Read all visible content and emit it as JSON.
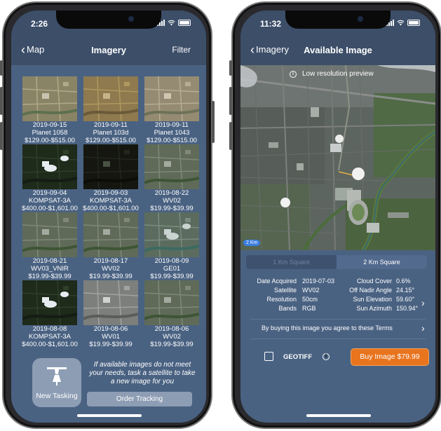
{
  "imagery_screen": {
    "status_time": "2:26",
    "back_label": "Map",
    "title": "Imagery",
    "filter_label": "Filter",
    "tiles": [
      {
        "date": "2019-09-15",
        "satellite": "Planet 1058",
        "price": "$129.00-$515.00",
        "scene": "urban-tan"
      },
      {
        "date": "2019-09-11",
        "satellite": "Planet 103d",
        "price": "$129.00-$515.00",
        "scene": "urban-gold"
      },
      {
        "date": "2019-09-11",
        "satellite": "Planet 1043",
        "price": "$129.00-$515.00",
        "scene": "urban-beige"
      },
      {
        "date": "2019-09-04",
        "satellite": "KOMPSAT-3A",
        "price": "$400.00-$1,601.00",
        "scene": "dark-cloud"
      },
      {
        "date": "2019-09-03",
        "satellite": "KOMPSAT-3A",
        "price": "$400.00-$1,601.00",
        "scene": "dark-black"
      },
      {
        "date": "2019-08-22",
        "satellite": "WV02",
        "price": "$19.99-$39.99",
        "scene": "green-urban"
      },
      {
        "date": "2019-08-21",
        "satellite": "WV03_VNIR",
        "price": "$19.99-$39.99",
        "scene": "green-urban"
      },
      {
        "date": "2019-08-17",
        "satellite": "WV02",
        "price": "$19.99-$39.99",
        "scene": "green-urban"
      },
      {
        "date": "2019-08-09",
        "satellite": "GE01",
        "price": "$19.99-$39.99",
        "scene": "green-teal"
      },
      {
        "date": "2019-08-08",
        "satellite": "KOMPSAT-3A",
        "price": "$400.00-$1,601.00",
        "scene": "dark-cloud"
      },
      {
        "date": "2019-08-06",
        "satellite": "WV01",
        "price": "$19.99-$39.99",
        "scene": "gray"
      },
      {
        "date": "2019-08-06",
        "satellite": "WV02",
        "price": "$19.99-$39.99",
        "scene": "green-urban"
      }
    ],
    "new_tasking_label": "New Tasking",
    "tasking_message": "If available images do not meet your needs, task a satellite to take a new image for you",
    "order_tracking_label": "Order Tracking"
  },
  "detail_screen": {
    "status_time": "11:32",
    "back_label": "Imagery",
    "title": "Available Image",
    "preview_note": "Low resolution preview",
    "scale_badge": "2 Km",
    "segments": [
      "1 Km Square",
      "2 Km Square"
    ],
    "selected_segment": "2 Km Square",
    "details_left": [
      {
        "label": "Date Acquired",
        "value": "2019-07-03"
      },
      {
        "label": "Satellite",
        "value": "WV02"
      },
      {
        "label": "Resolution",
        "value": "50cm"
      },
      {
        "label": "Bands",
        "value": "RGB"
      }
    ],
    "details_right": [
      {
        "label": "Cloud Cover",
        "value": "0.6%"
      },
      {
        "label": "Off Nadir Angle",
        "value": "24.15°"
      },
      {
        "label": "Sun Elevation",
        "value": "59.60°"
      },
      {
        "label": "Sun Azimuth",
        "value": "150.94°"
      }
    ],
    "terms_text": "By buying this image you agree to these Terms",
    "geotiff_label": "GEOTIFF",
    "geotiff_checked": false,
    "buy_label": "Buy Image $79.99"
  },
  "colors": {
    "background": "#4a6282",
    "navbar": "#3c4e68",
    "button_gray": "#8d9db4",
    "buy_orange": "#e8741e",
    "scale_blue": "#3b7de0"
  }
}
